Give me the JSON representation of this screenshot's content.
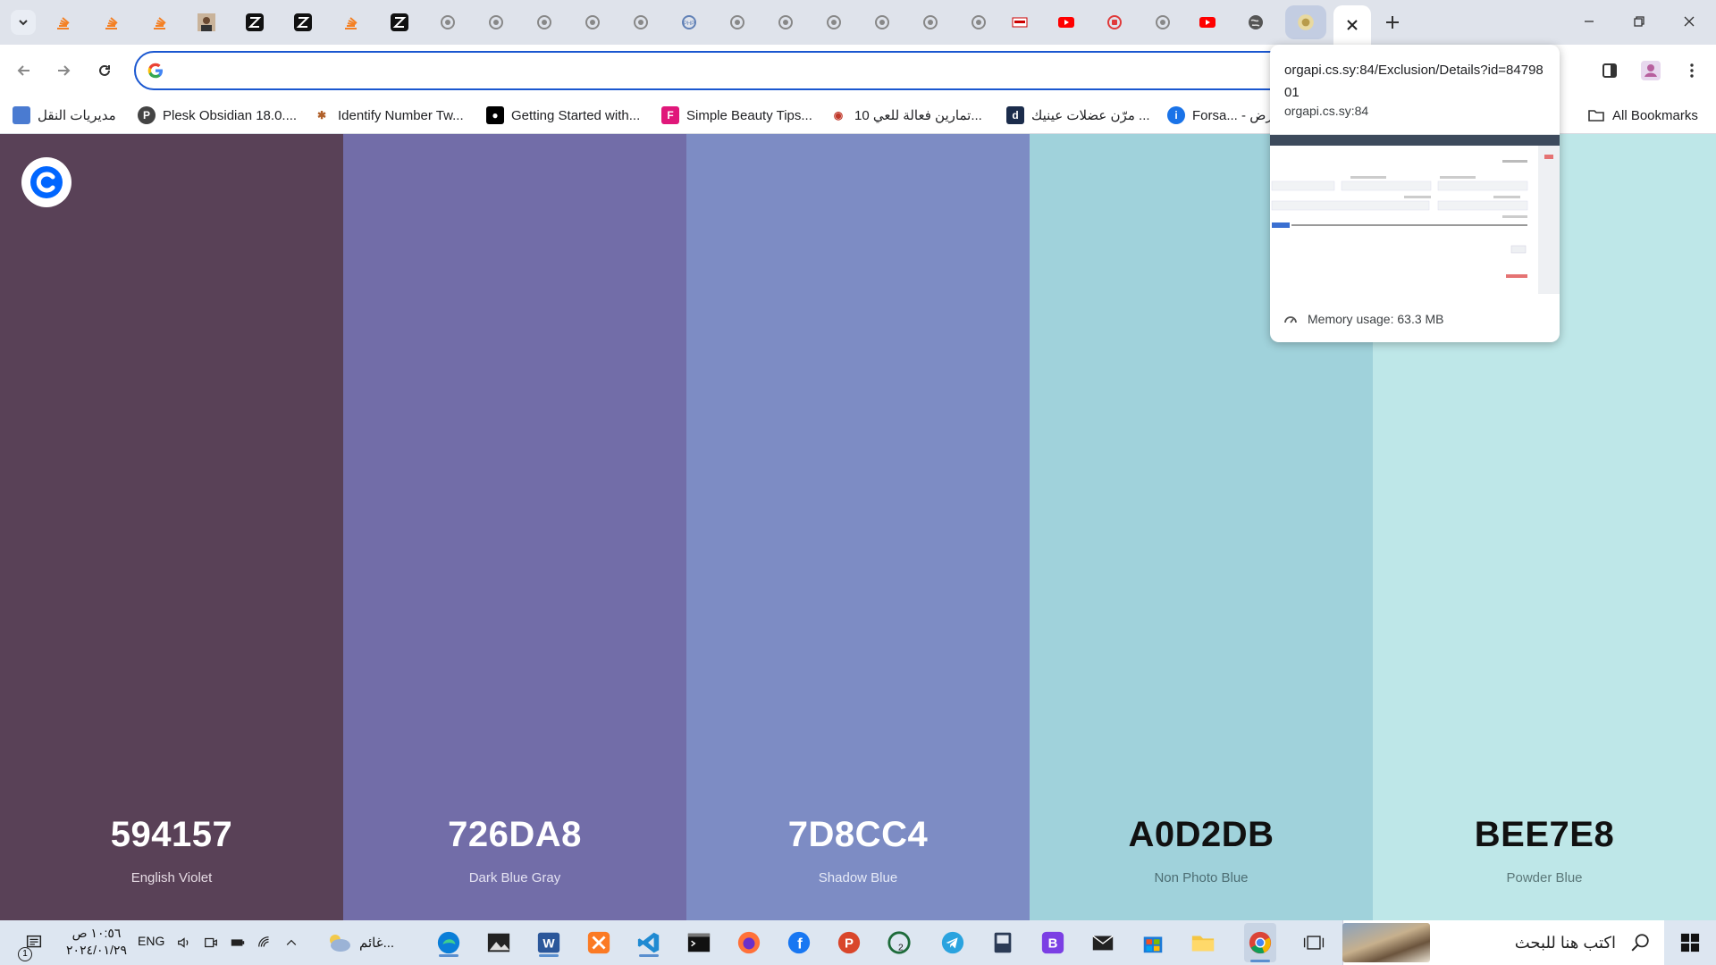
{
  "browser": {
    "omnibox_value": "",
    "bookmarks": [
      {
        "label": "مديريات النقل",
        "icon": "doc-icon",
        "color": "#4a7bd1"
      },
      {
        "label": "Plesk Obsidian 18.0....",
        "icon": "plesk-icon",
        "color": "#444444"
      },
      {
        "label": "Identify Number Tw...",
        "icon": "figure-icon",
        "color": "#b0602a"
      },
      {
        "label": "Getting Started with...",
        "icon": "medium-icon",
        "color": "#000000"
      },
      {
        "label": "Simple Beauty Tips...",
        "icon": "f-icon",
        "color": "#e0177a"
      },
      {
        "label": "10 تمارين فعالة للعي...",
        "icon": "eye-icon",
        "color": "#c0392b"
      },
      {
        "label": "مرّن عضلات عينيك ...",
        "icon": "d-icon",
        "color": "#1b2c4b"
      },
      {
        "label": "Forsa... - عرض",
        "icon": "info-icon",
        "color": "#1a73e8"
      }
    ],
    "all_bookmarks_label": "All Bookmarks"
  },
  "hover_card": {
    "title": "orgapi.cs.sy:84/Exclusion/Details?id=8479801",
    "domain": "orgapi.cs.sy:84",
    "memory": "Memory usage: 63.3 MB"
  },
  "palette": [
    {
      "hex": "594157",
      "name": "English Violet",
      "bg": "#594157",
      "fg": "#ffffff",
      "sub": "#e6dbe4"
    },
    {
      "hex": "726DA8",
      "name": "Dark Blue Gray",
      "bg": "#726DA8",
      "fg": "#ffffff",
      "sub": "#e4e2f2"
    },
    {
      "hex": "7D8CC4",
      "name": "Shadow Blue",
      "bg": "#7D8CC4",
      "fg": "#ffffff",
      "sub": "#e6eaf7"
    },
    {
      "hex": "A0D2DB",
      "name": "Non Photo Blue",
      "bg": "#A0D2DB",
      "fg": "#111111",
      "sub": "#4d6e74"
    },
    {
      "hex": "BEE7E8",
      "name": "Powder Blue",
      "bg": "#BEE7E8",
      "fg": "#111111",
      "sub": "#5b7879"
    }
  ],
  "taskbar": {
    "time": "١٠:٥٦ ص",
    "date": "٢٠٢٤/٠١/٢٩",
    "lang": "ENG",
    "weather": "غائم...",
    "search_placeholder": "اكتب هنا للبحث",
    "notification_count": "1"
  }
}
